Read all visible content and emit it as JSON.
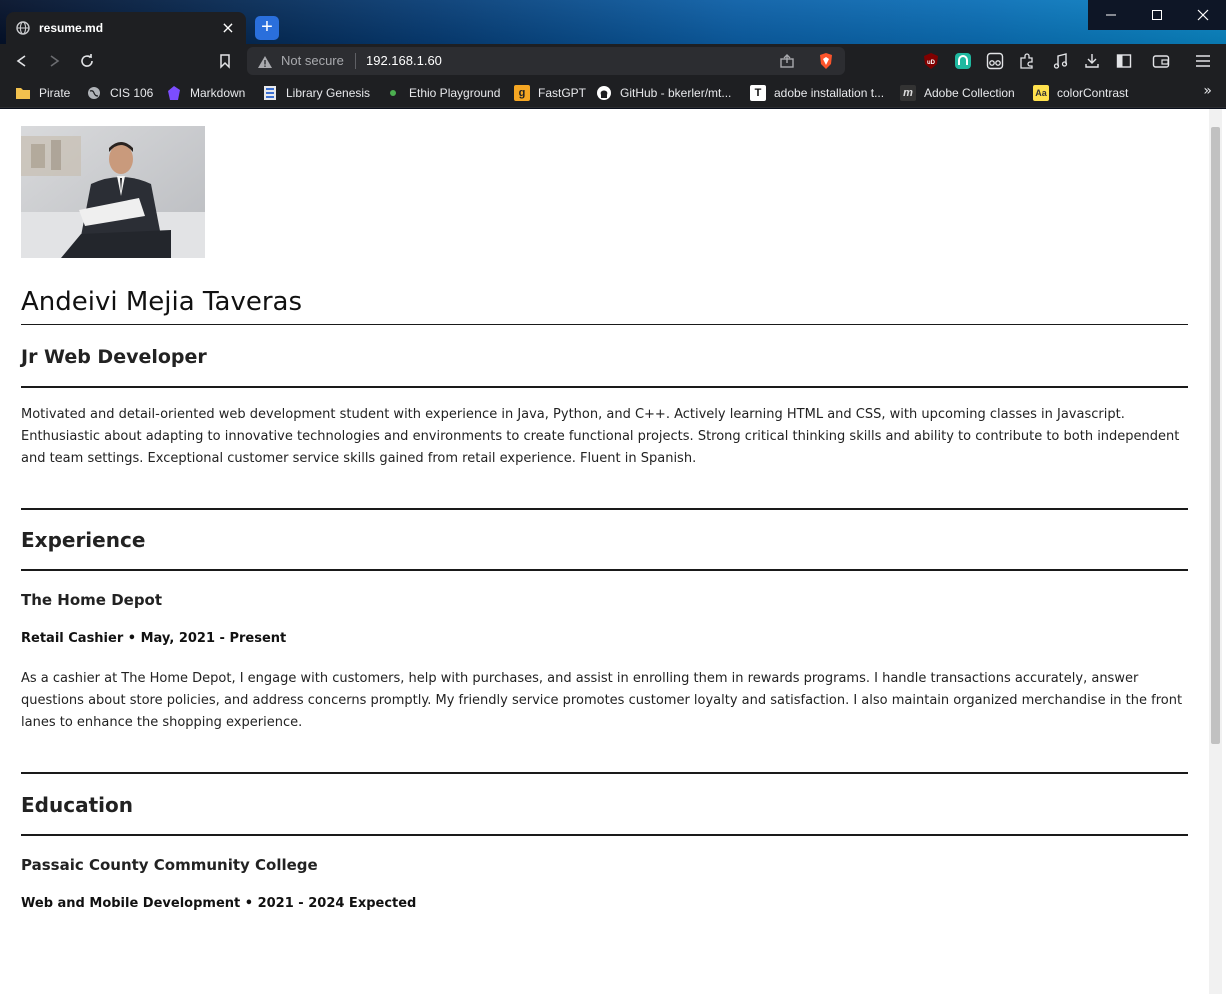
{
  "browser": {
    "tab_title": "resume.md",
    "tab_close": "×",
    "new_tab": "+",
    "window_controls": {
      "minimize": "minimize-icon",
      "maximize": "maximize-icon",
      "close": "close-icon"
    },
    "address": {
      "security_label": "Not secure",
      "url": "192.168.1.60"
    },
    "bookmarks": [
      {
        "label": "Pirate",
        "icon": "folder-icon",
        "color": "#f2c14e"
      },
      {
        "label": "CIS 106",
        "icon": "globe-icon",
        "color": "#b0b3b8"
      },
      {
        "label": "Markdown",
        "icon": "obsidian-icon",
        "color": "#7c4dff"
      },
      {
        "label": "Library Genesis",
        "icon": "library-icon",
        "color": "#3b6fd1"
      },
      {
        "label": "Ethio Playground",
        "icon": "dot-icon",
        "color": "#4caf50"
      },
      {
        "label": "FastGPT",
        "icon": "fastgpt-icon",
        "color": "#f5a623"
      },
      {
        "label": "GitHub - bkerler/mt...",
        "icon": "github-icon",
        "color": "#ffffff"
      },
      {
        "label": "adobe installation t...",
        "icon": "t-icon",
        "color": "#ffffff"
      },
      {
        "label": "Adobe Collection",
        "icon": "m-icon",
        "color": "#333333"
      },
      {
        "label": "colorContrast",
        "icon": "aa-icon",
        "color": "#ffe14d"
      }
    ],
    "bookmarks_overflow": "»"
  },
  "resume": {
    "name": "Andeivi Mejia Taveras",
    "role": "Jr Web Developer",
    "summary": "Motivated and detail-oriented web development student with experience in Java, Python, and C++. Actively learning HTML and CSS, with upcoming classes in Javascript. Enthusiastic about adapting to innovative technologies and environments to create functional projects. Strong critical thinking skills and ability to contribute to both independent and team settings. Exceptional customer service skills gained from retail experience. Fluent in Spanish.",
    "experience": {
      "heading": "Experience",
      "organization": "The Home Depot",
      "position": "Retail Cashier • May, 2021 - Present",
      "description": "As a cashier at The Home Depot, I engage with customers, help with purchases, and assist in enrolling them in rewards programs. I handle transactions accurately, answer questions about store policies, and address concerns promptly. My friendly service promotes customer loyalty and satisfaction. I also maintain organized merchandise in the front lanes to enhance the shopping experience."
    },
    "education": {
      "heading": "Education",
      "school": "Passaic County Community College",
      "program": "Web and Mobile Development • 2021 - 2024 Expected"
    }
  },
  "colors": {
    "tab_bg": "#1e1f22",
    "page_bg": "#ffffff",
    "rule": "#1a1a1a",
    "brave_accent": "#fb542b"
  }
}
